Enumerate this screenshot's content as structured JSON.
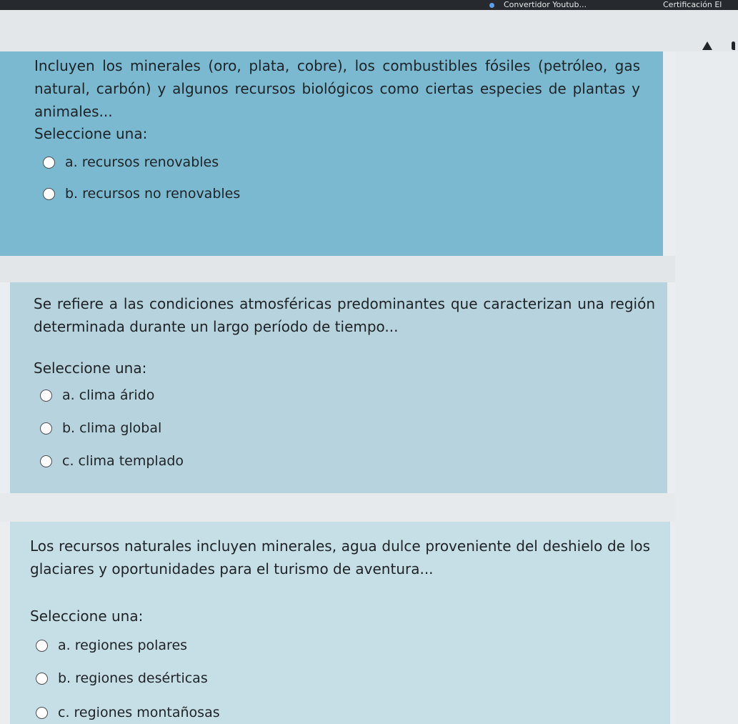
{
  "bookmarks": {
    "item1": "Convertidor Youtub...",
    "item2": "Certificación El"
  },
  "questions": [
    {
      "text": "Incluyen los minerales (oro, plata, cobre), los combustibles fósiles (petróleo, gas natural, carbón) y algunos recursos biológicos como ciertas especies de plantas y animales...",
      "prompt": "Seleccione una:",
      "options": [
        "a. recursos renovables",
        "b. recursos no renovables"
      ]
    },
    {
      "text": "Se refiere a las condiciones atmosféricas predominantes que caracterizan una región determinada durante un largo período de tiempo...",
      "prompt": "Seleccione una:",
      "options": [
        "a. clima árido",
        "b. clima global",
        "c. clima templado"
      ]
    },
    {
      "text": "Los recursos naturales incluyen minerales, agua dulce proveniente del deshielo de los glaciares y oportunidades para el turismo de aventura...",
      "prompt": "Seleccione una:",
      "options": [
        "a. regiones polares",
        "b. regiones desérticas",
        "c. regiones montañosas"
      ]
    }
  ],
  "colors": {
    "question1_bg": "#7ab9d0",
    "question2_bg": "#b7d3dd",
    "question3_bg": "#c6dee6"
  },
  "icons": {
    "notification": "bell-icon"
  }
}
